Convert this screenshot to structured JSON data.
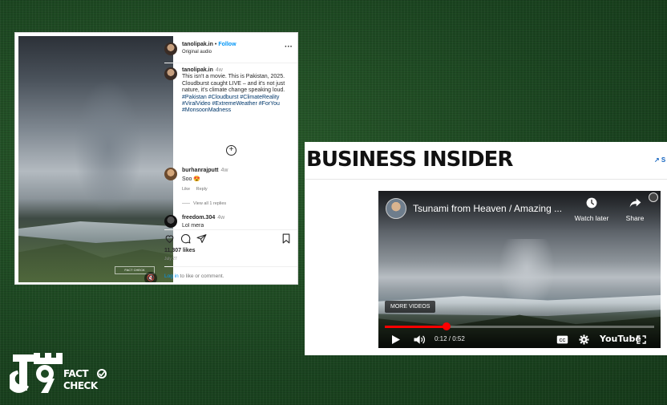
{
  "instagram": {
    "username": "tanolipak.in",
    "follow_label": "Follow",
    "audio_label": "Original audio",
    "more_label": "···",
    "caption_user": "tanolipak.in",
    "caption_time": "4w",
    "caption_lines": [
      "This isn't a movie. This is Pakistan, 2025.",
      "Cloudburst caught LIVE – and it's not just nature, it's climate change speaking loud."
    ],
    "hashtags": "#Pakistan #Cloudburst #ClimateReality #ViralVideo #ExtremeWeather #ForYou #MonsoonMadness",
    "comments": [
      {
        "user": "burhanrajputt",
        "time": "4w",
        "text": "Soo 😍",
        "like_label": "Like",
        "reply_label": "Reply",
        "view_replies": "View all 1 replies"
      },
      {
        "user": "freedom.304",
        "time": "4w",
        "text": "Lol mera"
      }
    ],
    "likes": "11,307 likes",
    "date": "July 27",
    "login_link": "Log in",
    "login_rest": " to like or comment.",
    "watermark": "FACT CHECK"
  },
  "business_insider": {
    "logo": "BUSINESS INSIDER",
    "subscribe_label": "↗ S"
  },
  "youtube": {
    "title": "Tsunami from Heaven / Amazing ...",
    "watch_later_label": "Watch later",
    "share_label": "Share",
    "more_videos_label": "MORE VIDEOS",
    "time": "0:12 / 0:52",
    "progress": 0.23,
    "logo": "YouTube"
  },
  "tv9": {
    "fact": "FACT",
    "check": "CHECK"
  },
  "colors": {
    "ig_link": "#0095f6",
    "ig_hashtag": "#00376b",
    "yt_red": "#ff0000",
    "bi_blue": "#1565c0"
  }
}
